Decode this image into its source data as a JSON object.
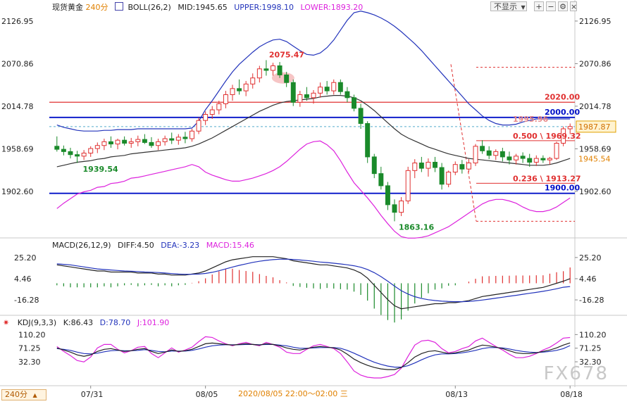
{
  "header": {
    "symbol": "现货黄金",
    "period": "240分",
    "indicator": "BOLL(26,2)",
    "mid": "MID:1945.65",
    "upper": "UPPER:1998.10",
    "lower": "LOWER:1893.20",
    "restore_button": "不显示",
    "macd_title": "MACD(26,12,9)",
    "diff": "DIFF:4.50",
    "dea": "DEA:-3.23",
    "macd": "MACD:15.46",
    "kdj_title": "KDJ(9,3,3)",
    "k": "K:86.43",
    "d": "D:78.70",
    "j": "J:101.90",
    "timeframe": "240分",
    "crosshair_time": "2020/08/05 22:00～02:00 三",
    "watermark": "FX678"
  },
  "colors": {
    "up": "#e03030",
    "down": "#1a8a2a",
    "mid": "#333333",
    "upper": "#2233bb",
    "lower": "#dd22dd",
    "hline": "#0010c8",
    "fib": "#e03030"
  },
  "chart_data": [
    {
      "type": "candlestick",
      "title": "现货黄金 240分",
      "y_ticks": [
        "2126.95",
        "2070.86",
        "2014.78",
        "1958.69",
        "1902.60"
      ],
      "y_tick_values": [
        2126.95,
        2070.86,
        2014.78,
        1958.69,
        1902.6
      ],
      "ylim": [
        1845,
        2138
      ],
      "x_ticks": [
        "07/31",
        "08/05",
        "08/13",
        "08/18"
      ],
      "x_tick_index": [
        5,
        22,
        59,
        76
      ],
      "current_price": "1987.87",
      "side_label": "1945.54",
      "annotations": {
        "high": "2075.47",
        "low1": "1939.54",
        "low2": "1863.16",
        "mid_label": "1995.96",
        "fib_500": "0.500 \\ 1969.32",
        "fib_236": "0.236 \\ 1913.27",
        "line_2020": "2020.00",
        "line_2000": "2000.00",
        "line_1900": "1900.00"
      },
      "ohlc": [
        [
          1962,
          1975,
          1955,
          1958
        ],
        [
          1958,
          1963,
          1950,
          1955
        ],
        [
          1955,
          1960,
          1946,
          1951
        ],
        [
          1951,
          1956,
          1940,
          1949
        ],
        [
          1949,
          1957,
          1944,
          1953
        ],
        [
          1953,
          1962,
          1948,
          1959
        ],
        [
          1959,
          1967,
          1953,
          1963
        ],
        [
          1963,
          1972,
          1957,
          1968
        ],
        [
          1968,
          1975,
          1960,
          1965
        ],
        [
          1965,
          1972,
          1958,
          1970
        ],
        [
          1970,
          1975,
          1963,
          1966
        ],
        [
          1966,
          1973,
          1960,
          1968
        ],
        [
          1968,
          1976,
          1962,
          1971
        ],
        [
          1971,
          1978,
          1965,
          1967
        ],
        [
          1967,
          1974,
          1960,
          1963
        ],
        [
          1963,
          1972,
          1957,
          1968
        ],
        [
          1968,
          1976,
          1963,
          1972
        ],
        [
          1972,
          1980,
          1965,
          1970
        ],
        [
          1970,
          1978,
          1964,
          1974
        ],
        [
          1974,
          1981,
          1966,
          1972
        ],
        [
          1972,
          1985,
          1968,
          1982
        ],
        [
          1982,
          2000,
          1978,
          1996
        ],
        [
          1996,
          2008,
          1990,
          2004
        ],
        [
          2004,
          2015,
          1998,
          2010
        ],
        [
          2010,
          2022,
          2004,
          2018
        ],
        [
          2018,
          2035,
          2012,
          2030
        ],
        [
          2030,
          2043,
          2022,
          2038
        ],
        [
          2038,
          2050,
          2030,
          2035
        ],
        [
          2035,
          2048,
          2028,
          2044
        ],
        [
          2044,
          2058,
          2038,
          2052
        ],
        [
          2052,
          2068,
          2046,
          2064
        ],
        [
          2064,
          2075.47,
          2055,
          2062
        ],
        [
          2062,
          2072,
          2055,
          2068
        ],
        [
          2068,
          2073,
          2052,
          2056
        ],
        [
          2056,
          2060,
          2040,
          2046
        ],
        [
          2046,
          2050,
          2015,
          2020
        ],
        [
          2020,
          2035,
          2014,
          2030
        ],
        [
          2030,
          2040,
          2022,
          2026
        ],
        [
          2026,
          2036,
          2018,
          2032
        ],
        [
          2032,
          2046,
          2026,
          2040
        ],
        [
          2040,
          2048,
          2030,
          2035
        ],
        [
          2035,
          2050,
          2030,
          2046
        ],
        [
          2046,
          2050,
          2030,
          2034
        ],
        [
          2034,
          2040,
          2020,
          2026
        ],
        [
          2026,
          2030,
          2008,
          2012
        ],
        [
          2012,
          2018,
          1985,
          1992
        ],
        [
          1992,
          1995,
          1940,
          1948
        ],
        [
          1948,
          1952,
          1920,
          1926
        ],
        [
          1926,
          1935,
          1905,
          1910
        ],
        [
          1910,
          1915,
          1878,
          1885
        ],
        [
          1885,
          1892,
          1863.16,
          1875
        ],
        [
          1875,
          1895,
          1870,
          1890
        ],
        [
          1890,
          1935,
          1886,
          1930
        ],
        [
          1930,
          1945,
          1920,
          1940
        ],
        [
          1940,
          1948,
          1928,
          1933
        ],
        [
          1933,
          1946,
          1922,
          1941
        ],
        [
          1941,
          1948,
          1928,
          1934
        ],
        [
          1934,
          1940,
          1905,
          1912
        ],
        [
          1912,
          1930,
          1908,
          1928
        ],
        [
          1928,
          1942,
          1924,
          1938
        ],
        [
          1938,
          1944,
          1926,
          1932
        ],
        [
          1932,
          1945,
          1928,
          1940
        ],
        [
          1940,
          1965,
          1936,
          1962
        ],
        [
          1962,
          1970,
          1952,
          1956
        ],
        [
          1956,
          1962,
          1945,
          1950
        ],
        [
          1950,
          1958,
          1944,
          1955
        ],
        [
          1955,
          1960,
          1942,
          1948
        ],
        [
          1948,
          1955,
          1938,
          1944
        ],
        [
          1944,
          1952,
          1938,
          1949
        ],
        [
          1949,
          1954,
          1940,
          1946
        ],
        [
          1946,
          1952,
          1935,
          1941
        ],
        [
          1941,
          1950,
          1936,
          1946
        ],
        [
          1946,
          1950,
          1940,
          1944
        ],
        [
          1944,
          1948,
          1938,
          1946
        ],
        [
          1946,
          1968,
          1944,
          1966
        ],
        [
          1966,
          1988,
          1962,
          1985
        ],
        [
          1985,
          1992,
          1978,
          1988
        ]
      ],
      "boll_mid": [
        1935,
        1937,
        1939,
        1941,
        1942,
        1943,
        1945,
        1946,
        1948,
        1949,
        1950,
        1952,
        1953,
        1954,
        1955,
        1956,
        1957,
        1958,
        1959,
        1960,
        1962,
        1965,
        1969,
        1973,
        1978,
        1983,
        1988,
        1993,
        1998,
        2003,
        2008,
        2012,
        2016,
        2019,
        2021,
        2022,
        2023,
        2024,
        2025,
        2027,
        2028,
        2029,
        2029,
        2028,
        2026,
        2022,
        2016,
        2009,
        2001,
        1993,
        1985,
        1978,
        1973,
        1969,
        1965,
        1961,
        1958,
        1955,
        1952,
        1950,
        1948,
        1946,
        1945,
        1944,
        1943,
        1942,
        1941,
        1940,
        1939,
        1938,
        1937,
        1937,
        1937,
        1938,
        1940,
        1943,
        1946
      ],
      "boll_upper": [
        1990,
        1987,
        1985,
        1983,
        1982,
        1982,
        1982,
        1983,
        1983,
        1984,
        1984,
        1984,
        1985,
        1985,
        1985,
        1985,
        1985,
        1985,
        1985,
        1985,
        1986,
        1995,
        2010,
        2022,
        2035,
        2048,
        2060,
        2070,
        2078,
        2086,
        2093,
        2098,
        2102,
        2103,
        2100,
        2094,
        2088,
        2083,
        2082,
        2085,
        2092,
        2102,
        2115,
        2128,
        2138,
        2140,
        2138,
        2135,
        2131,
        2126,
        2120,
        2113,
        2105,
        2097,
        2088,
        2078,
        2068,
        2058,
        2048,
        2038,
        2028,
        2018,
        2010,
        2002,
        1996,
        1992,
        1990,
        1990,
        1991,
        1994,
        1996,
        1998,
        1998,
        1998,
        1998,
        1998,
        1998
      ],
      "boll_lower": [
        1880,
        1887,
        1893,
        1899,
        1902,
        1904,
        1908,
        1909,
        1913,
        1914,
        1916,
        1920,
        1921,
        1923,
        1925,
        1927,
        1929,
        1931,
        1933,
        1935,
        1938,
        1935,
        1928,
        1924,
        1921,
        1918,
        1916,
        1916,
        1918,
        1920,
        1923,
        1926,
        1930,
        1935,
        1942,
        1950,
        1958,
        1965,
        1968,
        1969,
        1964,
        1956,
        1943,
        1928,
        1914,
        1904,
        1894,
        1883,
        1871,
        1860,
        1850,
        1843,
        1841,
        1841,
        1842,
        1844,
        1848,
        1852,
        1856,
        1862,
        1868,
        1874,
        1880,
        1886,
        1890,
        1892,
        1892,
        1890,
        1887,
        1882,
        1878,
        1876,
        1876,
        1878,
        1882,
        1888,
        1894
      ],
      "macd_diff": [
        18,
        17,
        16,
        15,
        14,
        13,
        12,
        12,
        11,
        11,
        11,
        11,
        10,
        10,
        10,
        9,
        9,
        8,
        8,
        8,
        9,
        10,
        12,
        15,
        18,
        21,
        23,
        24,
        25,
        26,
        26,
        26,
        26,
        25,
        24,
        22,
        21,
        20,
        19,
        18,
        18,
        17,
        16,
        15,
        13,
        10,
        5,
        -2,
        -9,
        -16,
        -22,
        -25,
        -24,
        -23,
        -22,
        -21,
        -20,
        -20,
        -19,
        -19,
        -18,
        -17,
        -15,
        -13,
        -12,
        -11,
        -10,
        -9,
        -8,
        -7,
        -6,
        -5,
        -4,
        -2,
        0,
        2,
        4.5
      ],
      "macd_dea": [
        19,
        18.5,
        18,
        17,
        16,
        15,
        14,
        13.5,
        13,
        12.5,
        12,
        11.8,
        11.5,
        11,
        10.8,
        10.5,
        10,
        9.5,
        9,
        8.8,
        8.8,
        9,
        9.6,
        10.7,
        12.2,
        14,
        15.9,
        17.5,
        19,
        20.4,
        21.5,
        22.4,
        23.1,
        23.5,
        23.6,
        23.3,
        22.8,
        22.2,
        21.5,
        20.8,
        20.3,
        19.6,
        18.9,
        18.1,
        17.1,
        15.7,
        13.5,
        10.4,
        6.5,
        2,
        -2.8,
        -7.3,
        -10.6,
        -13.1,
        -14.9,
        -16.1,
        -16.9,
        -17.5,
        -17.8,
        -18,
        -18,
        -17.8,
        -17.2,
        -16.4,
        -15.5,
        -14.6,
        -13.7,
        -12.7,
        -11.8,
        -10.8,
        -9.8,
        -8.9,
        -7.9,
        -6.7,
        -5.4,
        -3.9,
        -3.23
      ],
      "macd_bar_scale": 2,
      "kdj_k": [
        72,
        66,
        60,
        52,
        48,
        52,
        62,
        68,
        70,
        66,
        62,
        64,
        68,
        70,
        62,
        56,
        60,
        66,
        62,
        64,
        68,
        76,
        84,
        86,
        84,
        82,
        80,
        82,
        84,
        82,
        80,
        84,
        82,
        78,
        72,
        68,
        66,
        70,
        74,
        76,
        74,
        72,
        66,
        54,
        40,
        30,
        22,
        16,
        12,
        10,
        10,
        16,
        30,
        46,
        56,
        62,
        64,
        60,
        56,
        58,
        62,
        66,
        74,
        80,
        78,
        74,
        70,
        64,
        58,
        56,
        56,
        58,
        62,
        66,
        72,
        80,
        86.43
      ],
      "kdj_d": [
        70,
        68,
        65,
        60,
        56,
        55,
        57,
        61,
        64,
        65,
        64,
        64,
        65,
        67,
        65,
        62,
        61,
        63,
        63,
        63,
        65,
        69,
        74,
        78,
        80,
        81,
        81,
        81,
        82,
        82,
        81,
        82,
        82,
        80,
        78,
        74,
        71,
        71,
        72,
        73,
        73,
        73,
        71,
        65,
        57,
        48,
        39,
        31,
        25,
        20,
        17,
        17,
        21,
        29,
        38,
        46,
        52,
        55,
        55,
        56,
        58,
        61,
        65,
        70,
        73,
        73,
        72,
        69,
        65,
        62,
        60,
        59,
        60,
        62,
        65,
        70,
        78.7
      ],
      "kdj_j": [
        76,
        62,
        50,
        36,
        32,
        46,
        72,
        82,
        82,
        68,
        58,
        64,
        74,
        76,
        56,
        44,
        58,
        72,
        60,
        66,
        74,
        90,
        104,
        102,
        92,
        84,
        78,
        84,
        88,
        82,
        78,
        88,
        82,
        74,
        60,
        56,
        56,
        68,
        78,
        82,
        76,
        70,
        56,
        32,
        6,
        -6,
        -12,
        -14,
        -14,
        -10,
        -4,
        14,
        48,
        80,
        92,
        94,
        88,
        70,
        58,
        62,
        70,
        76,
        92,
        100,
        88,
        76,
        66,
        54,
        44,
        44,
        48,
        56,
        66,
        74,
        86,
        100,
        101.9
      ],
      "macd_y_ticks": [
        "25.20",
        "4.46",
        "-16.28"
      ],
      "macd_y_values": [
        25.2,
        4.46,
        -16.28
      ],
      "kdj_y_ticks": [
        "110.20",
        "71.25",
        "32.30"
      ],
      "kdj_y_values": [
        110.2,
        71.25,
        32.3
      ]
    }
  ]
}
